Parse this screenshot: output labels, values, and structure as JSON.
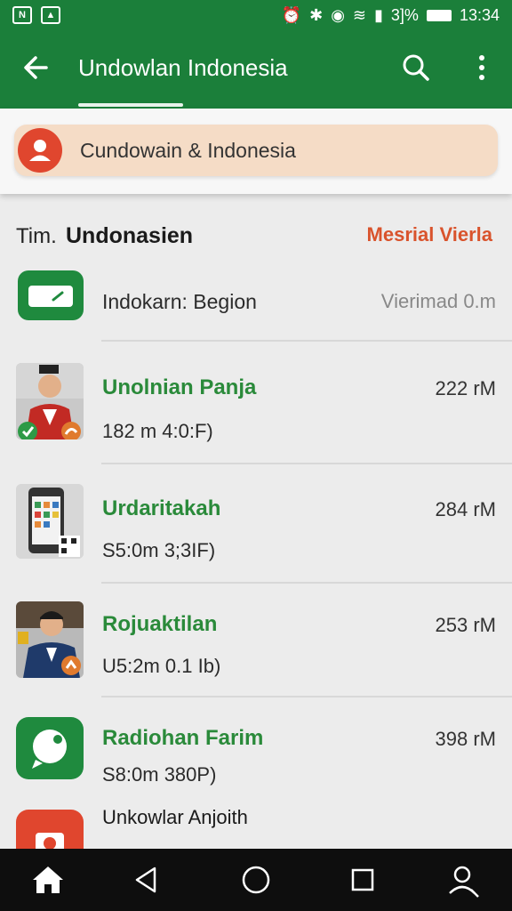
{
  "status_bar": {
    "left_icons": [
      "notification-icon",
      "image-icon"
    ],
    "battery": "3]%",
    "time": "13:34"
  },
  "appbar": {
    "back_icon": "back-arrow-icon",
    "title": "Undowlan Indonesia",
    "search_icon": "search-icon",
    "more_icon": "more-vert-icon"
  },
  "banner": {
    "label": "Cundowain & Indonesia",
    "avatar_icon": "person-icon"
  },
  "list_header": {
    "prefix": "Tim.",
    "name": "Undonasien",
    "link": "Mesrial Vierla"
  },
  "first_row": {
    "icon": "wallet-icon",
    "title": "Indokarn: Begion",
    "meta": "Vierimad 0.m"
  },
  "items": [
    {
      "title": "Unolnian Panja",
      "subtitle": "182 m 4:0:F)",
      "time": "222 rM",
      "thumb": "person-photo"
    },
    {
      "title": "Urdaritakah",
      "subtitle": "S5:0m 3;3IF)",
      "time": "284 rM",
      "thumb": "phone-photo"
    },
    {
      "title": "Rojuaktilan",
      "subtitle": "U5:2m 0.1 Ib)",
      "time": "253 rM",
      "thumb": "person-photo"
    },
    {
      "title": "Radiohan Farim",
      "subtitle": "S8:0m 380P)",
      "time": "398 rM",
      "thumb": "chat-icon"
    },
    {
      "title": "Unkowlar Anjoith",
      "subtitle": "",
      "time": "",
      "thumb": "camera-icon"
    }
  ],
  "nav": [
    "home-icon",
    "back-triangle-icon",
    "home-circle-icon",
    "recents-icon",
    "account-icon"
  ],
  "colors": {
    "primary": "#1b7f3a",
    "accent": "#d9532c",
    "banner": "#f5dcc6",
    "title_green": "#2a8a3a"
  }
}
